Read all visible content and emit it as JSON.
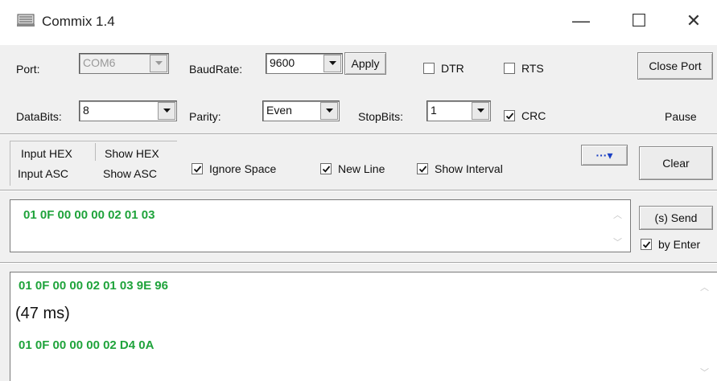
{
  "window": {
    "title": "Commix 1.4",
    "icon": "commix-app-icon",
    "controls": {
      "minimize": "—",
      "maximize": "☐",
      "close": "✕"
    }
  },
  "serial": {
    "port_label": "Port:",
    "port_value": "COM6",
    "baudrate_label": "BaudRate:",
    "baudrate_value": "9600",
    "apply_label": "Apply",
    "dtr_label": "DTR",
    "rts_label": "RTS",
    "close_port_label": "Close Port",
    "databits_label": "DataBits:",
    "databits_value": "8",
    "parity_label": "Parity:",
    "parity_value": "Even",
    "stopbits_label": "StopBits:",
    "stopbits_value": "1",
    "crc_label": "CRC",
    "pause_label": "Pause",
    "dtr_checked": false,
    "rts_checked": false,
    "crc_checked": true
  },
  "mode": {
    "input_hex": "Input HEX",
    "input_asc": "Input ASC",
    "show_hex": "Show HEX",
    "show_asc": "Show ASC",
    "ignore_space_label": "Ignore Space",
    "new_line_label": "New Line",
    "show_interval_label": "Show Interval",
    "more_label": "···▾",
    "clear_label": "Clear"
  },
  "send": {
    "input_value": "01 0F 00 00 00 02 01 03",
    "send_label": "(s) Send",
    "by_enter_label": "by Enter"
  },
  "output": {
    "lines": [
      {
        "text": "01 0F 00 00 02 01 03 9E 96",
        "kind": "data"
      },
      {
        "text": "(47 ms)",
        "kind": "interval"
      },
      {
        "text": "01 0F 00 00 00 02 D4 0A",
        "kind": "data"
      }
    ]
  },
  "colors": {
    "data_green": "#1fa33b",
    "window_bg": "#f0f0f0"
  }
}
